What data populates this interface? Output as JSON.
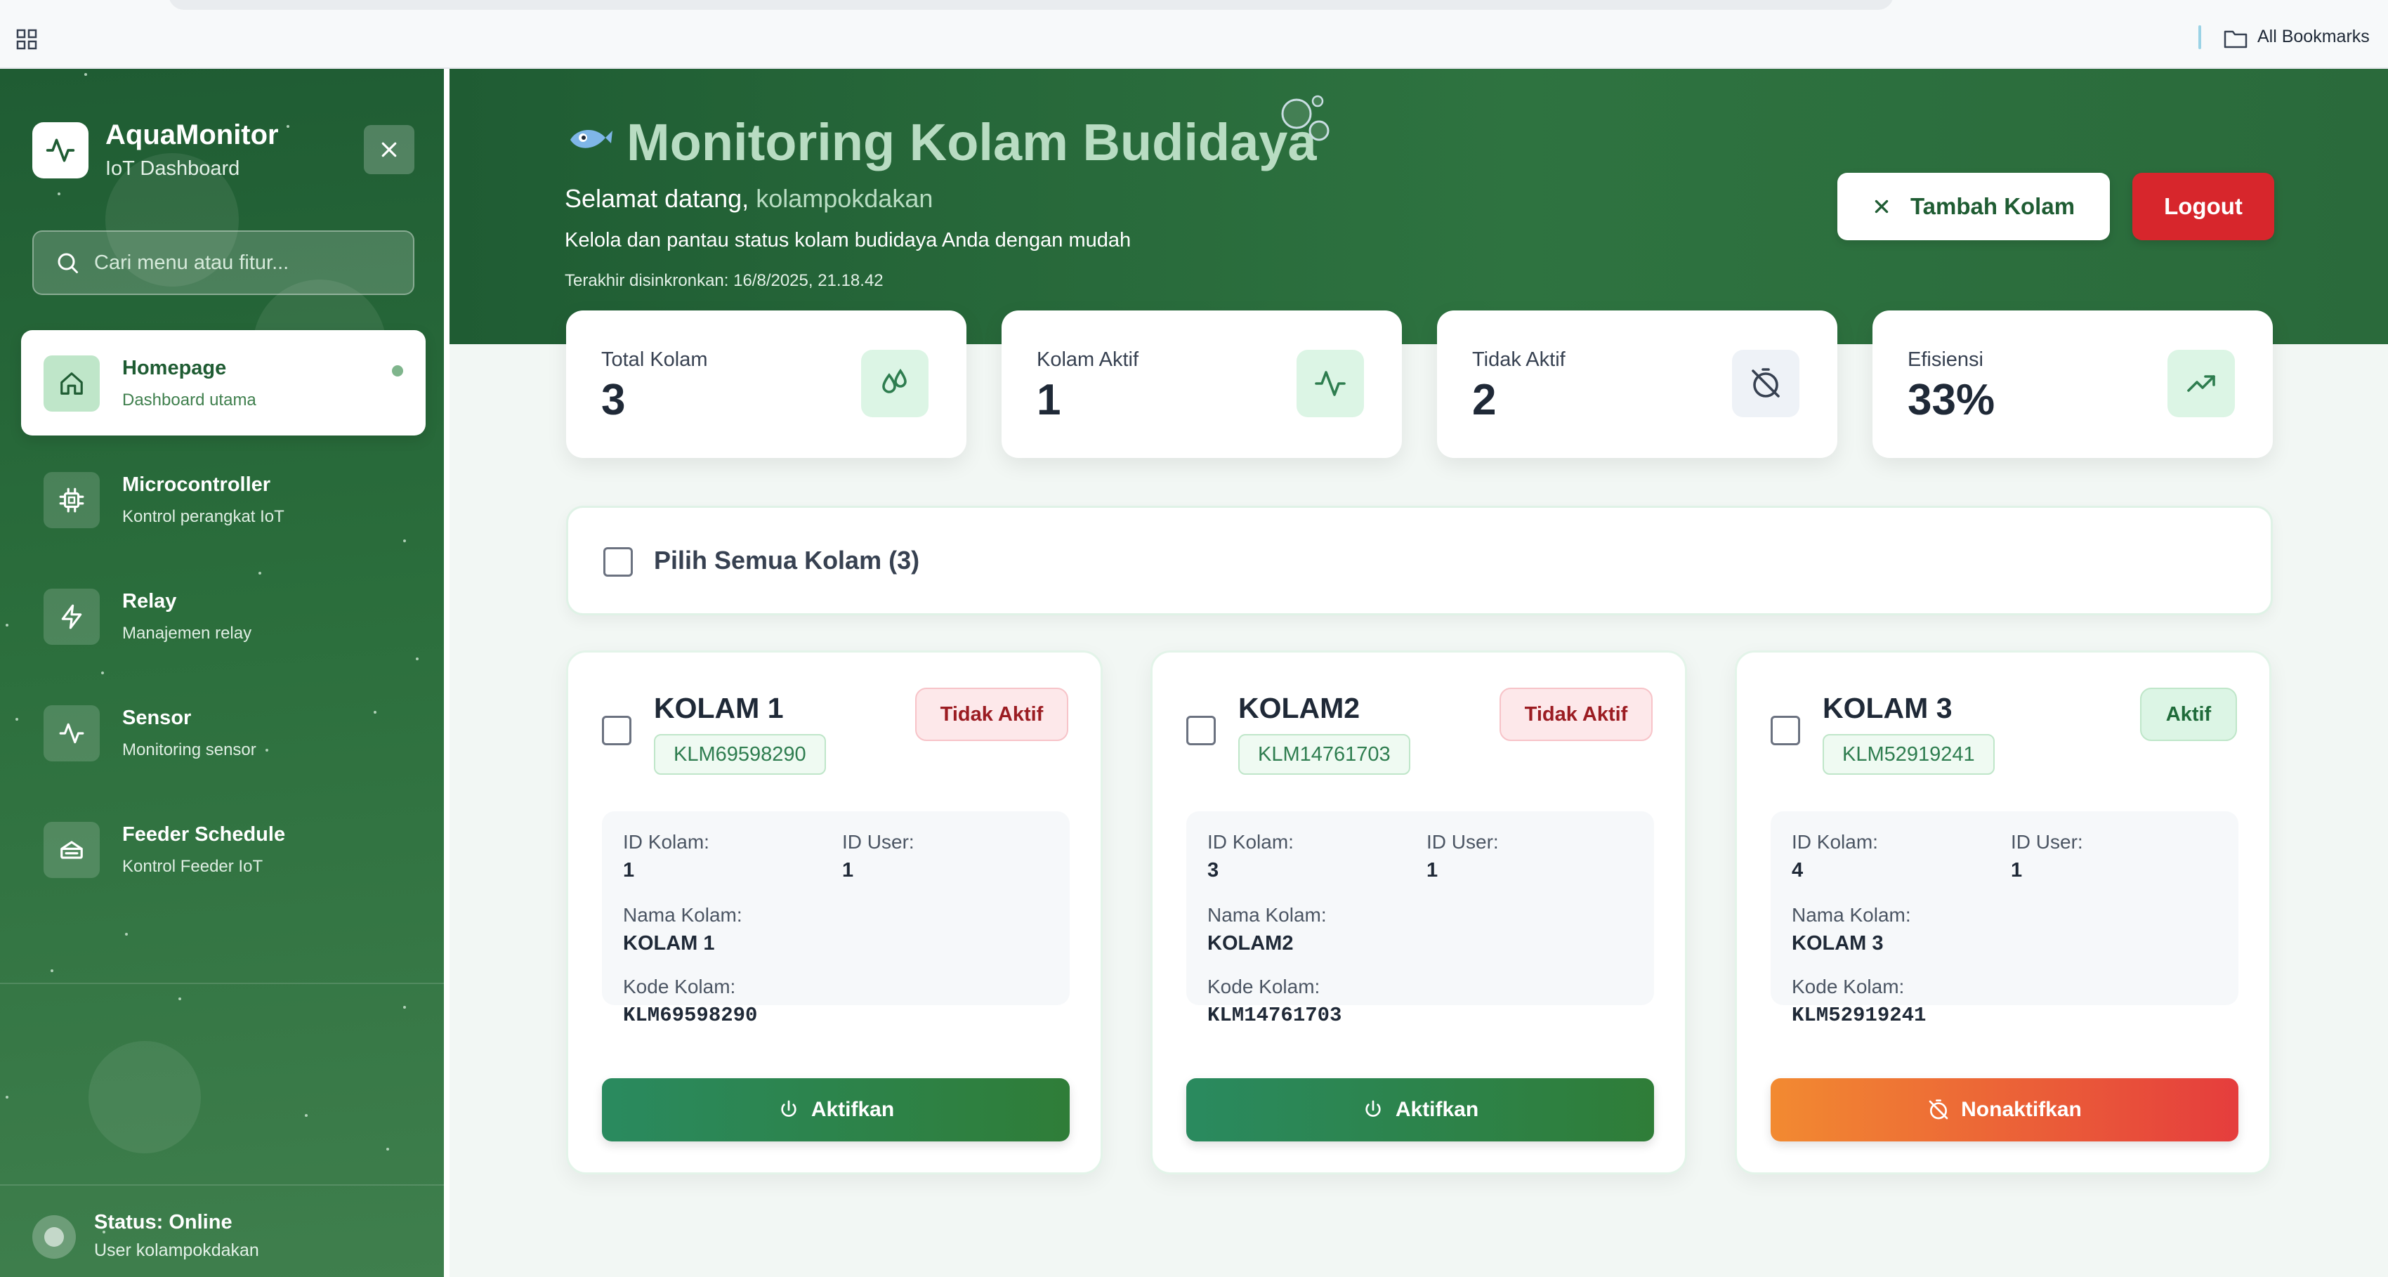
{
  "browser": {
    "bookmarks_label": "All Bookmarks"
  },
  "sidebar": {
    "brand_title": "AquaMonitor",
    "brand_subtitle": "IoT Dashboard",
    "search_placeholder": "Cari menu atau fitur...",
    "items": [
      {
        "label": "Homepage",
        "sub": "Dashboard utama",
        "icon": "home-icon",
        "active": true
      },
      {
        "label": "Microcontroller",
        "sub": "Kontrol perangkat IoT",
        "icon": "chip-icon",
        "active": false
      },
      {
        "label": "Relay",
        "sub": "Manajemen relay",
        "icon": "zap-icon",
        "active": false
      },
      {
        "label": "Sensor",
        "sub": "Monitoring sensor",
        "icon": "activity-icon",
        "active": false
      },
      {
        "label": "Feeder Schedule",
        "sub": "Kontrol Feeder IoT",
        "icon": "feeder-icon",
        "active": false
      }
    ],
    "status_title": "Status: Online",
    "status_user": "User kolampokdakan"
  },
  "header": {
    "title": "Monitoring Kolam Budidaya",
    "welcome_prefix": "Selamat datang,",
    "username": "kolampokdakan",
    "description": "Kelola dan pantau status kolam budidaya Anda dengan mudah",
    "last_sync": "Terakhir disinkronkan: 16/8/2025, 21.18.42",
    "add_button": "Tambah Kolam",
    "logout_button": "Logout"
  },
  "stats": [
    {
      "label": "Total Kolam",
      "value": "3",
      "icon": "droplets-icon"
    },
    {
      "label": "Kolam Aktif",
      "value": "1",
      "icon": "activity-icon"
    },
    {
      "label": "Tidak Aktif",
      "value": "2",
      "icon": "timer-off-icon"
    },
    {
      "label": "Efisiensi",
      "value": "33%",
      "icon": "trending-up-icon"
    }
  ],
  "select_all_label": "Pilih Semua Kolam (3)",
  "pond_labels": {
    "id_kolam": "ID Kolam:",
    "id_user": "ID User:",
    "nama_kolam": "Nama Kolam:",
    "kode_kolam": "Kode Kolam:"
  },
  "ponds": [
    {
      "name": "KOLAM 1",
      "code": "KLM69598290",
      "status": "Tidak Aktif",
      "active": false,
      "id_kolam": "1",
      "id_user": "1",
      "nama": "KOLAM 1",
      "kode": "KLM69598290",
      "button": "Aktifkan"
    },
    {
      "name": "KOLAM2",
      "code": "KLM14761703",
      "status": "Tidak Aktif",
      "active": false,
      "id_kolam": "3",
      "id_user": "1",
      "nama": "KOLAM2",
      "kode": "KLM14761703",
      "button": "Aktifkan"
    },
    {
      "name": "KOLAM 3",
      "code": "KLM52919241",
      "status": "Aktif",
      "active": true,
      "id_kolam": "4",
      "id_user": "1",
      "nama": "KOLAM 3",
      "kode": "KLM52919241",
      "button": "Nonaktifkan"
    }
  ],
  "colors": {
    "primary_green": "#1f5c33",
    "logout_red": "#d7262c",
    "active_green": "#2a8a5f",
    "deactivate_orange": "#f28a31"
  }
}
